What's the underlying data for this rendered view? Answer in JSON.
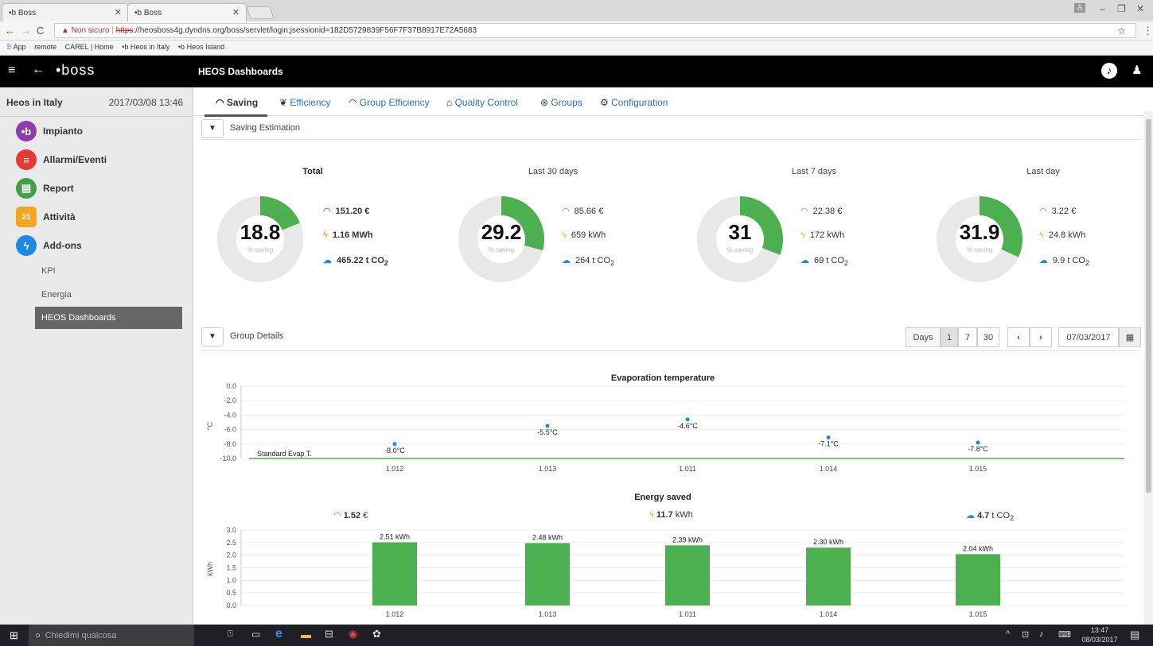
{
  "browser": {
    "tabs": [
      {
        "label": "•b Boss"
      },
      {
        "label": "•b Boss"
      }
    ],
    "insecure_label": "Non sicuro",
    "url_scheme": "https",
    "url_rest": "://heosboss4g.dyndns.org/boss/servlet/login;jsessionid=182D5729839F56F7F37B8917E72A5683",
    "bookmarks": [
      "App",
      "remote",
      "CAREL | Home",
      "•b Heos in Italy",
      "•b Heos Island"
    ]
  },
  "header": {
    "logo": "•boss",
    "title": "HEOS Dashboards"
  },
  "sidebar": {
    "site": "Heos in Italy",
    "datetime": "2017/03/08  13:46",
    "items": [
      {
        "label": "Impianto",
        "color": "#8e3ea8",
        "glyph": "•b"
      },
      {
        "label": "Allarmi/Eventi",
        "color": "#e53935",
        "glyph": "≡"
      },
      {
        "label": "Report",
        "color": "#43a047",
        "glyph": "▤"
      },
      {
        "label": "Attività",
        "color": "#f5a623",
        "glyph": "21"
      },
      {
        "label": "Add-ons",
        "color": "#1e88e5",
        "glyph": "ϟ"
      }
    ],
    "subitems": [
      "KPI",
      "Energia"
    ],
    "active_subitem": "HEOS Dashboards"
  },
  "tabs": [
    {
      "label": "Saving",
      "icon": "gauge-icon",
      "active": true
    },
    {
      "label": "Efficiency",
      "icon": "leaf-icon"
    },
    {
      "label": "Group Efficiency",
      "icon": "gauge-icon"
    },
    {
      "label": "Quality Control",
      "icon": "gauge-icon"
    },
    {
      "label": "Groups",
      "icon": "group-icon"
    },
    {
      "label": "Configuration",
      "icon": "cogs-icon"
    }
  ],
  "saving": {
    "section_label": "Saving Estimation",
    "sub_label": "% saving",
    "kpis": [
      {
        "title": "Total",
        "percent": 18.8,
        "percent_label": "18.8",
        "money": "151.20 €",
        "energy": "1.16 MWh",
        "co2": "465.22 t CO",
        "bold": true
      },
      {
        "title": "Last 30 days",
        "percent": 29.2,
        "percent_label": "29.2",
        "money": "85.66 €",
        "energy": "659 kWh",
        "co2": "264 t CO"
      },
      {
        "title": "Last 7 days",
        "percent": 31,
        "percent_label": "31",
        "money": "22.38 €",
        "energy": "172 kWh",
        "co2": "69 t CO"
      },
      {
        "title": "Last day",
        "percent": 31.9,
        "percent_label": "31.9",
        "money": "3.22 €",
        "energy": "24.8 kWh",
        "co2": "9.9 t CO"
      }
    ],
    "co2_sub": "2"
  },
  "group_details": {
    "section_label": "Group Details",
    "days_label": "Days",
    "day_options": [
      "1",
      "7",
      "30"
    ],
    "date": "07/03/2017"
  },
  "chart_data": [
    {
      "type": "scatter",
      "title": "Evaporation temperature",
      "ylabel": "°C",
      "categories": [
        "1.012",
        "1.013",
        "1.011",
        "1.014",
        "1.015"
      ],
      "values": [
        -8.0,
        -5.5,
        -4.6,
        -7.1,
        -7.8
      ],
      "data_labels": [
        "-8.0°C",
        "-5.5°C",
        "-4.6°C",
        "-7.1°C",
        "-7.8°C"
      ],
      "yticks": [
        "0.0",
        "-2.0",
        "-4.0",
        "-6.0",
        "-8.0",
        "-10.0"
      ],
      "ylim": [
        -10,
        0
      ],
      "reference_line": {
        "label": "Standard Evap T.",
        "value": -10.0
      },
      "grid": true
    },
    {
      "type": "bar",
      "title": "Energy saved",
      "ylabel": "kWh",
      "categories": [
        "1.012",
        "1.013",
        "1.011",
        "1.014",
        "1.015"
      ],
      "values": [
        2.51,
        2.48,
        2.39,
        2.3,
        2.04
      ],
      "data_labels": [
        "2.51 kWh",
        "2.48 kWh",
        "2.39 kWh",
        "2.30 kWh",
        "2.04 kWh"
      ],
      "yticks": [
        "3.0",
        "2.5",
        "2.0",
        "1.5",
        "1.0",
        "0.5",
        "0.0"
      ],
      "ylim": [
        0,
        3
      ],
      "grid": true,
      "summary": {
        "money_value": "1.52",
        "money_unit": "€",
        "energy_value": "11.7",
        "energy_unit": "kWh",
        "co2_value": "4.7",
        "co2_unit": "t CO"
      }
    }
  ],
  "colors": {
    "green": "#4caf50",
    "ring": "#e8e8e8",
    "blue": "#2a72c4",
    "orange": "#f5a623",
    "point": "#1e88e5"
  },
  "taskbar": {
    "search_placeholder": "Chiedimi qualcosa",
    "time": "13:47",
    "date": "08/03/2017"
  }
}
